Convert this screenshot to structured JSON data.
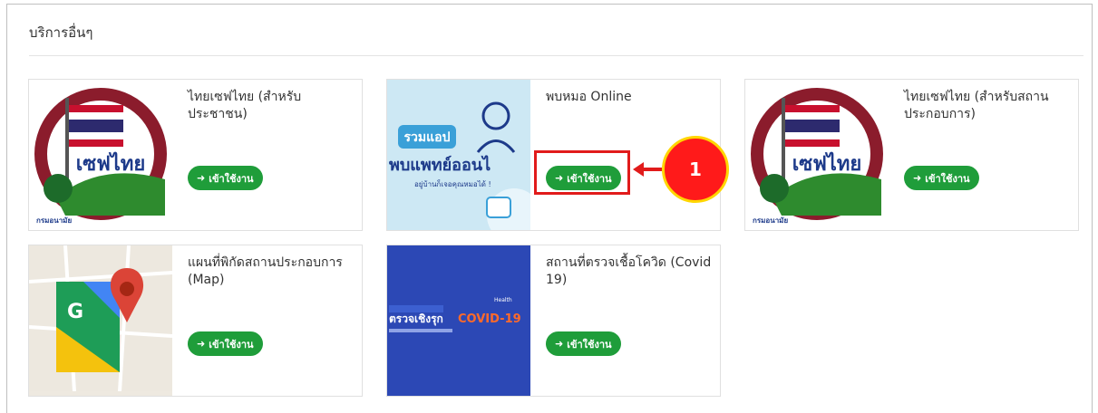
{
  "section": {
    "title": "บริการอื่นๆ"
  },
  "cards": [
    {
      "title": "ไทยเซฟไทย (สำหรับประชาชน)",
      "button_label": "เข้าใช้งาน",
      "image_text": "เซฟไทย",
      "image_caption": "กรมอนามัย"
    },
    {
      "title": "พบหมอ Online",
      "button_label": "เข้าใช้งาน",
      "image_text": "รวมแอป",
      "image_text2": "พบแพทย์ออนไ",
      "image_caption": "อยู่บ้านก็เจอคุณหมอได้ !"
    },
    {
      "title": "ไทยเซฟไทย (สำหรับสถานประกอบการ)",
      "button_label": "เข้าใช้งาน",
      "image_text": "เซฟไทย",
      "image_caption": "กรมอนามัย"
    },
    {
      "title": "แผนที่พิกัดสถานประกอบการ (Map)",
      "button_label": "เข้าใช้งาน",
      "image_text": "G"
    },
    {
      "title": "สถานที่ตรวจเชื้อโควิด (Covid 19)",
      "button_label": "เข้าใช้งาน",
      "image_text": "ตรวจเชิงรุก",
      "image_text2": "COVID-19",
      "image_caption": "Health"
    }
  ],
  "annotation": {
    "step_number": "1"
  },
  "icons": {
    "enter": "sign-in-icon"
  },
  "colors": {
    "button_green": "#1f9d3a",
    "annotation_red": "#e11b1b",
    "badge_yellow": "#ffd600"
  }
}
